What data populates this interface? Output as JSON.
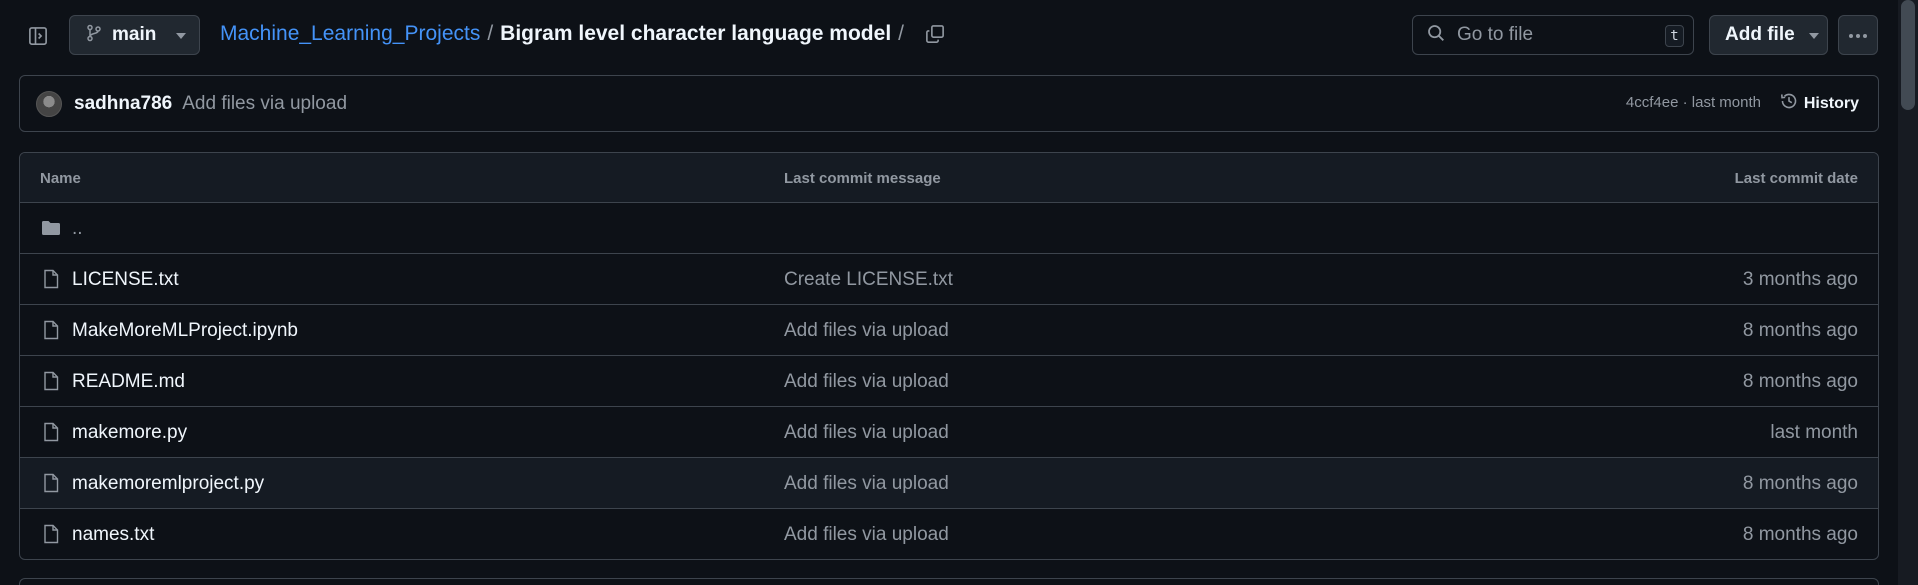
{
  "toolbar": {
    "branch": "main",
    "breadcrumb": {
      "repo": "Machine_Learning_Projects",
      "separator": "/",
      "current": "Bigram level character language model",
      "trailing": "/"
    },
    "search_placeholder": "Go to file",
    "search_shortcut": "t",
    "add_file_label": "Add file"
  },
  "commit": {
    "author": "sadhna786",
    "message": "Add files via upload",
    "sha": "4ccf4ee",
    "meta_sep": "·",
    "time": "last month",
    "history_label": "History"
  },
  "table": {
    "headers": {
      "name": "Name",
      "message": "Last commit message",
      "date": "Last commit date"
    },
    "parent": "..",
    "rows": [
      {
        "name": "LICENSE.txt",
        "message": "Create LICENSE.txt",
        "date": "3 months ago"
      },
      {
        "name": "MakeMoreMLProject.ipynb",
        "message": "Add files via upload",
        "date": "8 months ago"
      },
      {
        "name": "README.md",
        "message": "Add files via upload",
        "date": "8 months ago"
      },
      {
        "name": "makemore.py",
        "message": "Add files via upload",
        "date": "last month"
      },
      {
        "name": "makemoremlproject.py",
        "message": "Add files via upload",
        "date": "8 months ago"
      },
      {
        "name": "names.txt",
        "message": "Add files via upload",
        "date": "8 months ago"
      }
    ]
  },
  "icons": {
    "sidebar_toggle": "sidebar-expand-icon",
    "branch": "git-branch-icon",
    "caret": "triangle-down-icon",
    "copy": "copy-icon",
    "search": "search-icon",
    "more": "kebab-horizontal-icon",
    "history": "history-icon",
    "folder": "folder-icon",
    "file": "file-icon"
  },
  "colors": {
    "background": "#0d1117",
    "link": "#4493f8",
    "border": "#3d444d",
    "muted": "#9198a1"
  }
}
